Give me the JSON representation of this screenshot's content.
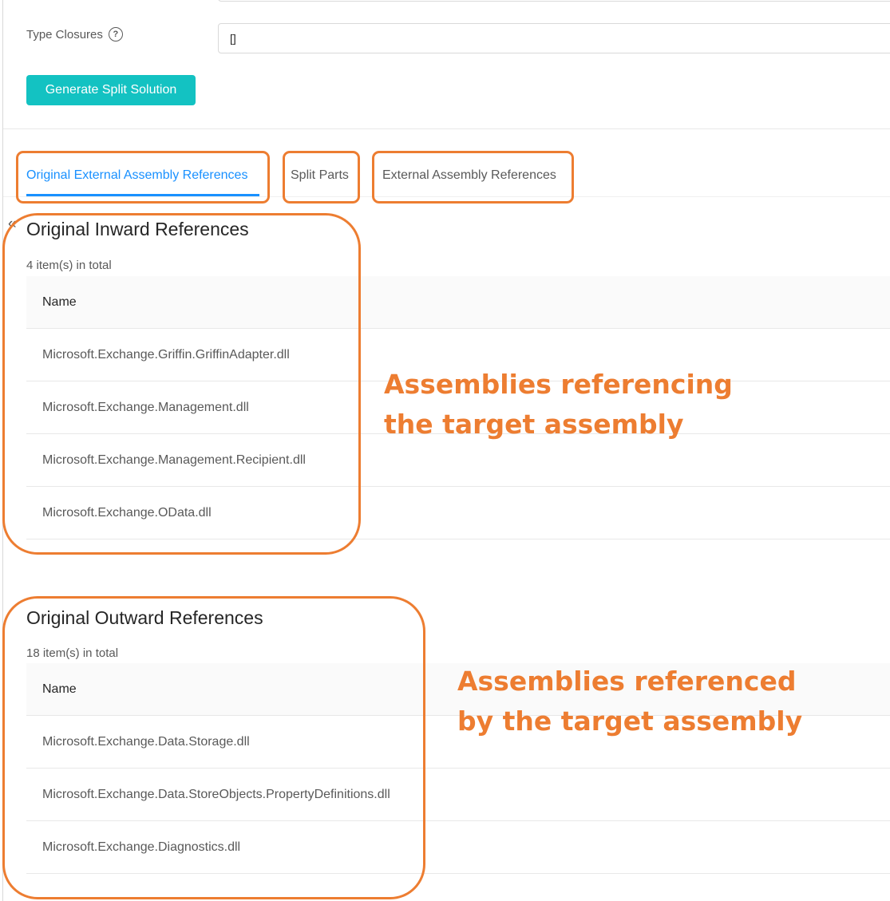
{
  "form": {
    "type_closures_label": "Type Closures",
    "type_closures_value": "[]",
    "generate_button": "Generate Split Solution"
  },
  "tabs": [
    {
      "label": "Original External Assembly References",
      "active": true
    },
    {
      "label": "Split Parts",
      "active": false
    },
    {
      "label": "External Assembly References",
      "active": false
    }
  ],
  "inward": {
    "title": "Original Inward References",
    "count": "4 item(s) in total",
    "column": "Name",
    "rows": [
      "Microsoft.Exchange.Griffin.GriffinAdapter.dll",
      "Microsoft.Exchange.Management.dll",
      "Microsoft.Exchange.Management.Recipient.dll",
      "Microsoft.Exchange.OData.dll"
    ]
  },
  "outward": {
    "title": "Original Outward References",
    "count": "18 item(s) in total",
    "column": "Name",
    "rows": [
      "Microsoft.Exchange.Data.Storage.dll",
      "Microsoft.Exchange.Data.StoreObjects.PropertyDefinitions.dll",
      "Microsoft.Exchange.Diagnostics.dll"
    ]
  },
  "annotations": {
    "inward": [
      "Assemblies referencing",
      "the target assembly"
    ],
    "outward": [
      "Assemblies referenced",
      "by the target assembly"
    ]
  },
  "colors": {
    "primary": "#13c2c2",
    "tab_active": "#1890ff",
    "annotation": "#ed7d31"
  },
  "icons": {
    "help": "question-circle-icon",
    "collapse": "double-chevron-left-icon"
  }
}
